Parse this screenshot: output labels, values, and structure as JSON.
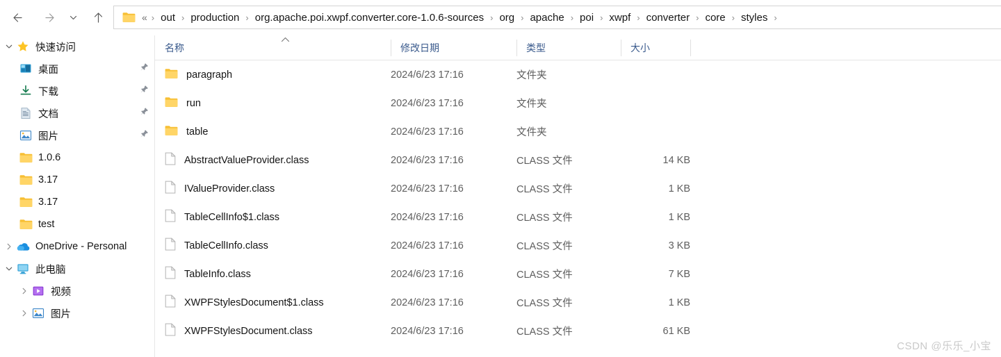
{
  "navbar": {
    "back_label": "Back",
    "forward_label": "Forward",
    "recent_label": "Recent locations",
    "up_label": "Up one level",
    "address": {
      "leading_chevrons": "«",
      "separator": "›",
      "crumbs": [
        "out",
        "production",
        "org.apache.poi.xwpf.converter.core-1.0.6-sources",
        "org",
        "apache",
        "poi",
        "xwpf",
        "converter",
        "core",
        "styles"
      ]
    }
  },
  "sidebar": {
    "items": [
      {
        "label": "快速访问",
        "icon": "star-icon",
        "level": 0,
        "expanded": true,
        "pinned": false
      },
      {
        "label": "桌面",
        "icon": "desktop-icon",
        "level": 1,
        "pinned": true
      },
      {
        "label": "下载",
        "icon": "downloads-icon",
        "level": 1,
        "pinned": true
      },
      {
        "label": "文档",
        "icon": "documents-icon",
        "level": 1,
        "pinned": true
      },
      {
        "label": "图片",
        "icon": "pictures-icon",
        "level": 1,
        "pinned": true
      },
      {
        "label": "1.0.6",
        "icon": "folder-icon",
        "level": 1,
        "pinned": false
      },
      {
        "label": "3.17",
        "icon": "folder-icon",
        "level": 1,
        "pinned": false
      },
      {
        "label": "3.17",
        "icon": "folder-icon",
        "level": 1,
        "pinned": false
      },
      {
        "label": "test",
        "icon": "folder-icon",
        "level": 1,
        "pinned": false
      },
      {
        "label": "OneDrive - Personal",
        "icon": "onedrive-icon",
        "level": 0,
        "expanded": false,
        "pinned": false
      },
      {
        "label": "此电脑",
        "icon": "this-pc-icon",
        "level": 0,
        "expanded": true,
        "pinned": false
      },
      {
        "label": "视频",
        "icon": "videos-icon",
        "level": 1,
        "expanded": false,
        "pinned": false
      },
      {
        "label": "图片",
        "icon": "pictures-icon",
        "level": 1,
        "expanded": false,
        "pinned": false
      }
    ]
  },
  "filelist": {
    "columns": [
      {
        "key": "name",
        "label": "名称",
        "sorted": "asc"
      },
      {
        "key": "date",
        "label": "修改日期"
      },
      {
        "key": "type",
        "label": "类型"
      },
      {
        "key": "size",
        "label": "大小"
      }
    ],
    "sort_caret": "ⱏ",
    "rows": [
      {
        "name": "paragraph",
        "date": "2024/6/23 17:16",
        "type": "文件夹",
        "size": "",
        "icon": "folder-icon"
      },
      {
        "name": "run",
        "date": "2024/6/23 17:16",
        "type": "文件夹",
        "size": "",
        "icon": "folder-icon"
      },
      {
        "name": "table",
        "date": "2024/6/23 17:16",
        "type": "文件夹",
        "size": "",
        "icon": "folder-icon"
      },
      {
        "name": "AbstractValueProvider.class",
        "date": "2024/6/23 17:16",
        "type": "CLASS 文件",
        "size": "14 KB",
        "icon": "file-icon"
      },
      {
        "name": "IValueProvider.class",
        "date": "2024/6/23 17:16",
        "type": "CLASS 文件",
        "size": "1 KB",
        "icon": "file-icon"
      },
      {
        "name": "TableCellInfo$1.class",
        "date": "2024/6/23 17:16",
        "type": "CLASS 文件",
        "size": "1 KB",
        "icon": "file-icon"
      },
      {
        "name": "TableCellInfo.class",
        "date": "2024/6/23 17:16",
        "type": "CLASS 文件",
        "size": "3 KB",
        "icon": "file-icon"
      },
      {
        "name": "TableInfo.class",
        "date": "2024/6/23 17:16",
        "type": "CLASS 文件",
        "size": "7 KB",
        "icon": "file-icon"
      },
      {
        "name": "XWPFStylesDocument$1.class",
        "date": "2024/6/23 17:16",
        "type": "CLASS 文件",
        "size": "1 KB",
        "icon": "file-icon"
      },
      {
        "name": "XWPFStylesDocument.class",
        "date": "2024/6/23 17:16",
        "type": "CLASS 文件",
        "size": "61 KB",
        "icon": "file-icon"
      }
    ]
  },
  "watermark": {
    "text": "CSDN @乐乐_小宝"
  },
  "colors": {
    "folder": "#fcc73f",
    "folder_light": "#ffd966",
    "header_text": "#3a5a8c",
    "accent_blue": "#0078d4",
    "divider": "#e6e6e6"
  }
}
